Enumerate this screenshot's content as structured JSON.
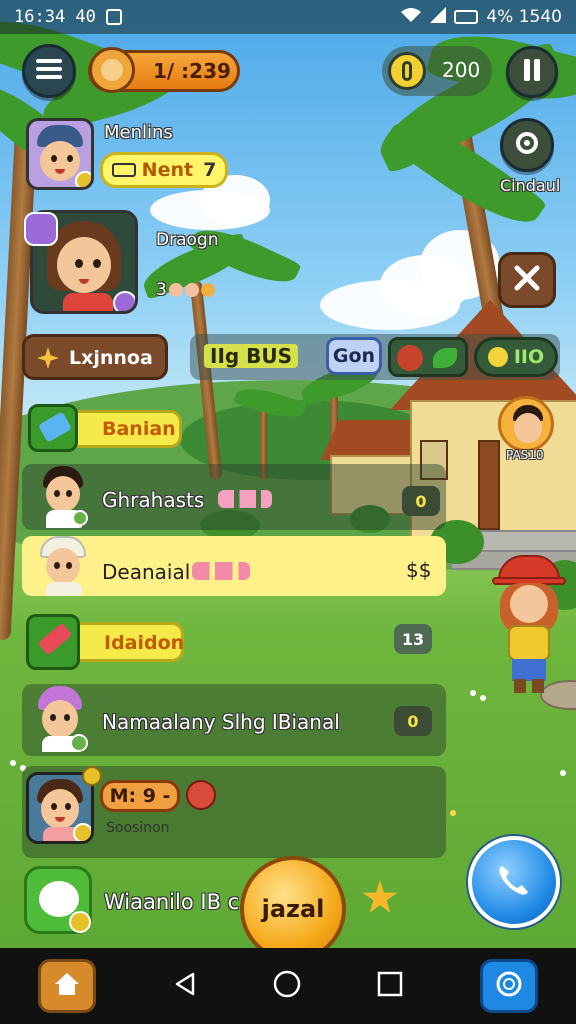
{
  "status_bar": {
    "time": "16:34 40",
    "right_text": "4% 1540"
  },
  "top_bar": {
    "coins": "1/ :239",
    "currency_value": "200"
  },
  "right_buttons": {
    "cloud_label": "Cindaul"
  },
  "profiles": [
    {
      "name": "Menlins",
      "tag": "Nent",
      "tag_number": "7"
    },
    {
      "name": "Draogn",
      "score": "3"
    }
  ],
  "tabs": {
    "left": "Lxjnnoa",
    "center": "IIg BUS",
    "button": "Gon",
    "right_value": "IIO"
  },
  "side_character": {
    "label": "PAS10"
  },
  "list": [
    {
      "type": "banner",
      "label": "Banian"
    },
    {
      "type": "row",
      "label": "Ghrahasts",
      "action": "0"
    },
    {
      "type": "row-highlight",
      "label": "Deanaial",
      "action": "$$"
    },
    {
      "type": "banner",
      "label": "Idaidon",
      "action": "13"
    },
    {
      "type": "row",
      "label": "Namaalany Slhg IBianal",
      "action": "0"
    },
    {
      "type": "row",
      "label": "M: 9 -",
      "sublabel": "Soosinon"
    },
    {
      "type": "row",
      "label": "Wiaanilo IB c"
    }
  ],
  "center_button": "jazal",
  "colors": {
    "accent_orange": "#f08a1f",
    "accent_yellow": "#fff18a",
    "call_blue": "#1e88e5",
    "dark_button": "#2a4651"
  },
  "icons": [
    "menu-icon",
    "pause-icon",
    "close-icon",
    "call-icon",
    "home-icon",
    "back-icon",
    "circle-home-icon",
    "recent-icon",
    "chat-icon",
    "star-icon"
  ]
}
